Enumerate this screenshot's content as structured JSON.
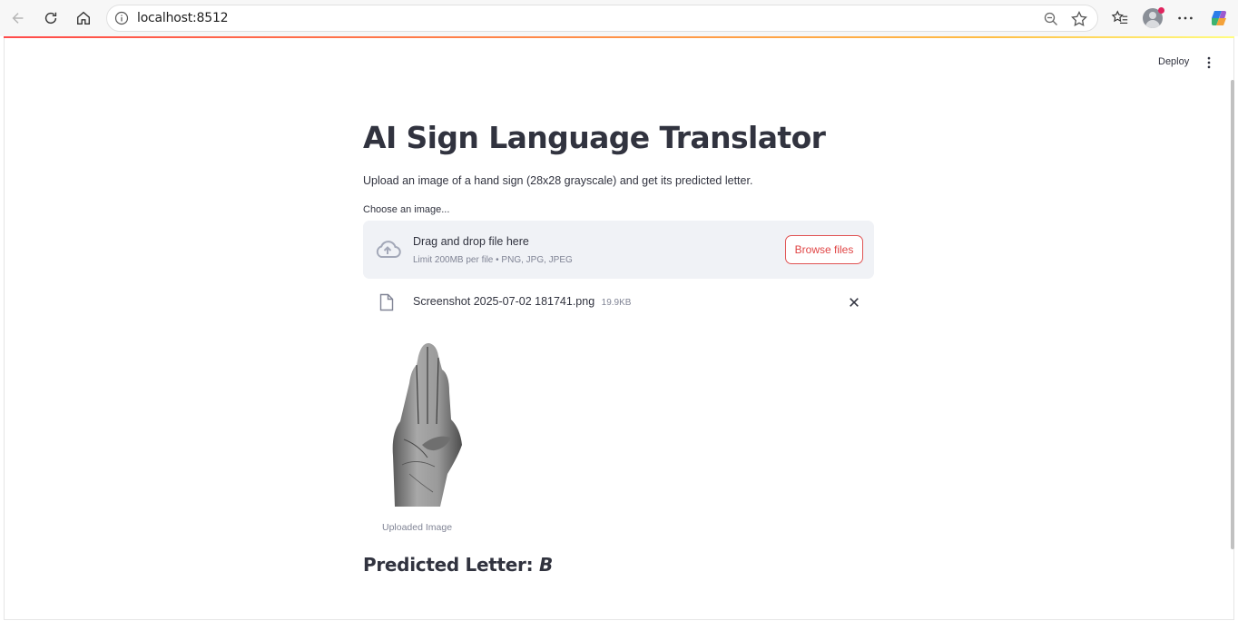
{
  "browser": {
    "url": "localhost:8512"
  },
  "header": {
    "deploy_label": "Deploy"
  },
  "main": {
    "title": "AI Sign Language Translator",
    "description": "Upload an image of a hand sign (28x28 grayscale) and get its predicted letter.",
    "uploader_label": "Choose an image...",
    "dropzone": {
      "text": "Drag and drop file here",
      "limit": "Limit 200MB per file • PNG, JPG, JPEG",
      "browse_label": "Browse files"
    },
    "file": {
      "name": "Screenshot 2025-07-02 181741.png",
      "size": "19.9KB"
    },
    "image_caption": "Uploaded Image",
    "prediction_label": "Predicted Letter:",
    "prediction_value": "B"
  },
  "colors": {
    "accent": "#ff4b4b",
    "text": "#31333f",
    "muted": "#808495",
    "dropzone_bg": "#f0f2f6"
  },
  "icons": [
    "back-icon",
    "reload-icon",
    "home-icon",
    "info-icon",
    "zoom-icon",
    "star-icon",
    "favorites-icon",
    "profile-icon",
    "more-icon",
    "copilot-icon",
    "kebab-menu-icon",
    "cloud-upload-icon",
    "file-icon",
    "close-icon"
  ]
}
